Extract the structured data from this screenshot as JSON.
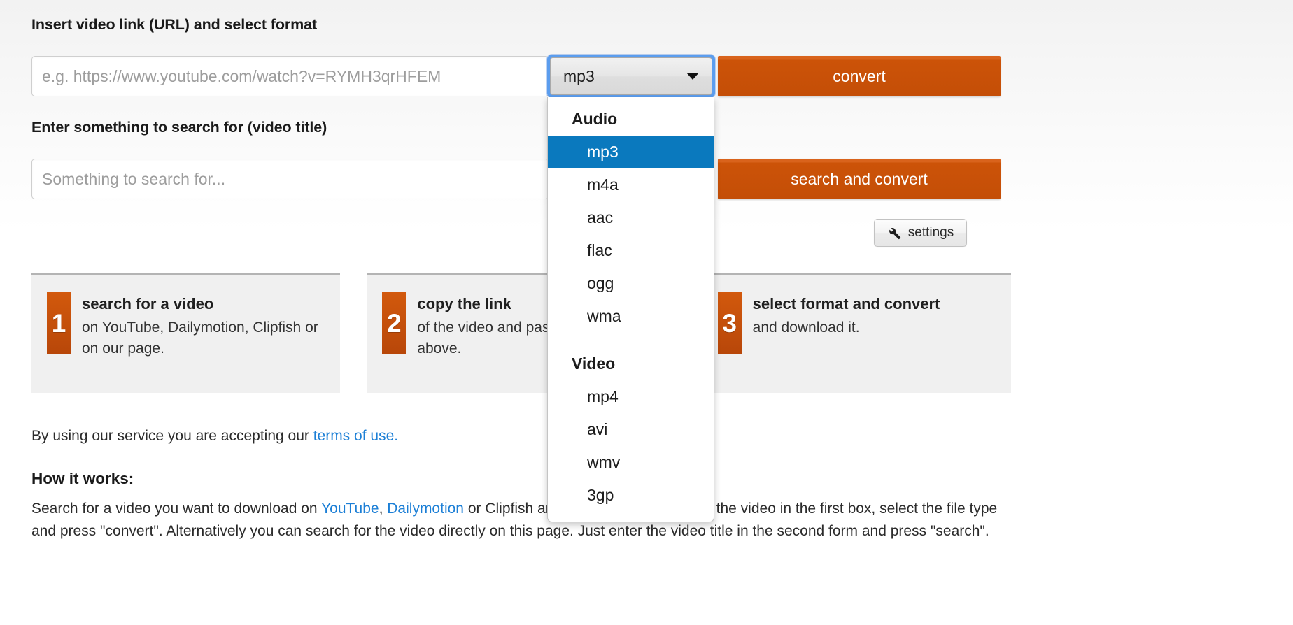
{
  "form": {
    "url_label": "Insert video link (URL) and select format",
    "url_placeholder": "e.g. https://www.youtube.com/watch?v=RYMH3qrHFEM",
    "url_value": "",
    "search_label": "Enter something to search for (video title)",
    "search_placeholder": "Something to search for...",
    "search_value": "",
    "convert_button": "convert",
    "search_convert_button": "search and convert",
    "settings_button": "settings",
    "settings_icon": "wrench-icon",
    "format_select": {
      "selected": "mp3",
      "arrow_icon": "chevron-down-icon",
      "expanded": true,
      "groups": [
        {
          "label": "Audio",
          "options": [
            "mp3",
            "m4a",
            "aac",
            "flac",
            "ogg",
            "wma"
          ]
        },
        {
          "label": "Video",
          "options": [
            "mp4",
            "avi",
            "wmv",
            "3gp"
          ]
        }
      ]
    }
  },
  "steps": [
    {
      "number": "1",
      "title": "search for a video",
      "desc": "on YouTube, Dailymotion, Clipfish or on our page."
    },
    {
      "number": "2",
      "title": "copy the link",
      "desc": "of the video and paste it in the box above."
    },
    {
      "number": "3",
      "title": "select format and convert",
      "desc": "and download it."
    }
  ],
  "terms": {
    "prefix": "By using our service you are accepting our ",
    "link": "terms of use."
  },
  "how": {
    "heading": "How it works:",
    "part1": "Search for a video you want to download on ",
    "link_youtube": "YouTube",
    "comma": ", ",
    "link_dailymotion": "Dailymotion",
    "part2": " or Clipfish and paste the link (URL) of the video in the first box, select the file type and press \"convert\". Alternatively you can search for the video directly on this page. Just enter the video title in the second form and press \"search\"."
  },
  "colors": {
    "accent_orange": "#cc5308",
    "highlight_blue": "#0a79be",
    "link_blue": "#1c7fd6",
    "focus_ring": "#5b9dee"
  }
}
